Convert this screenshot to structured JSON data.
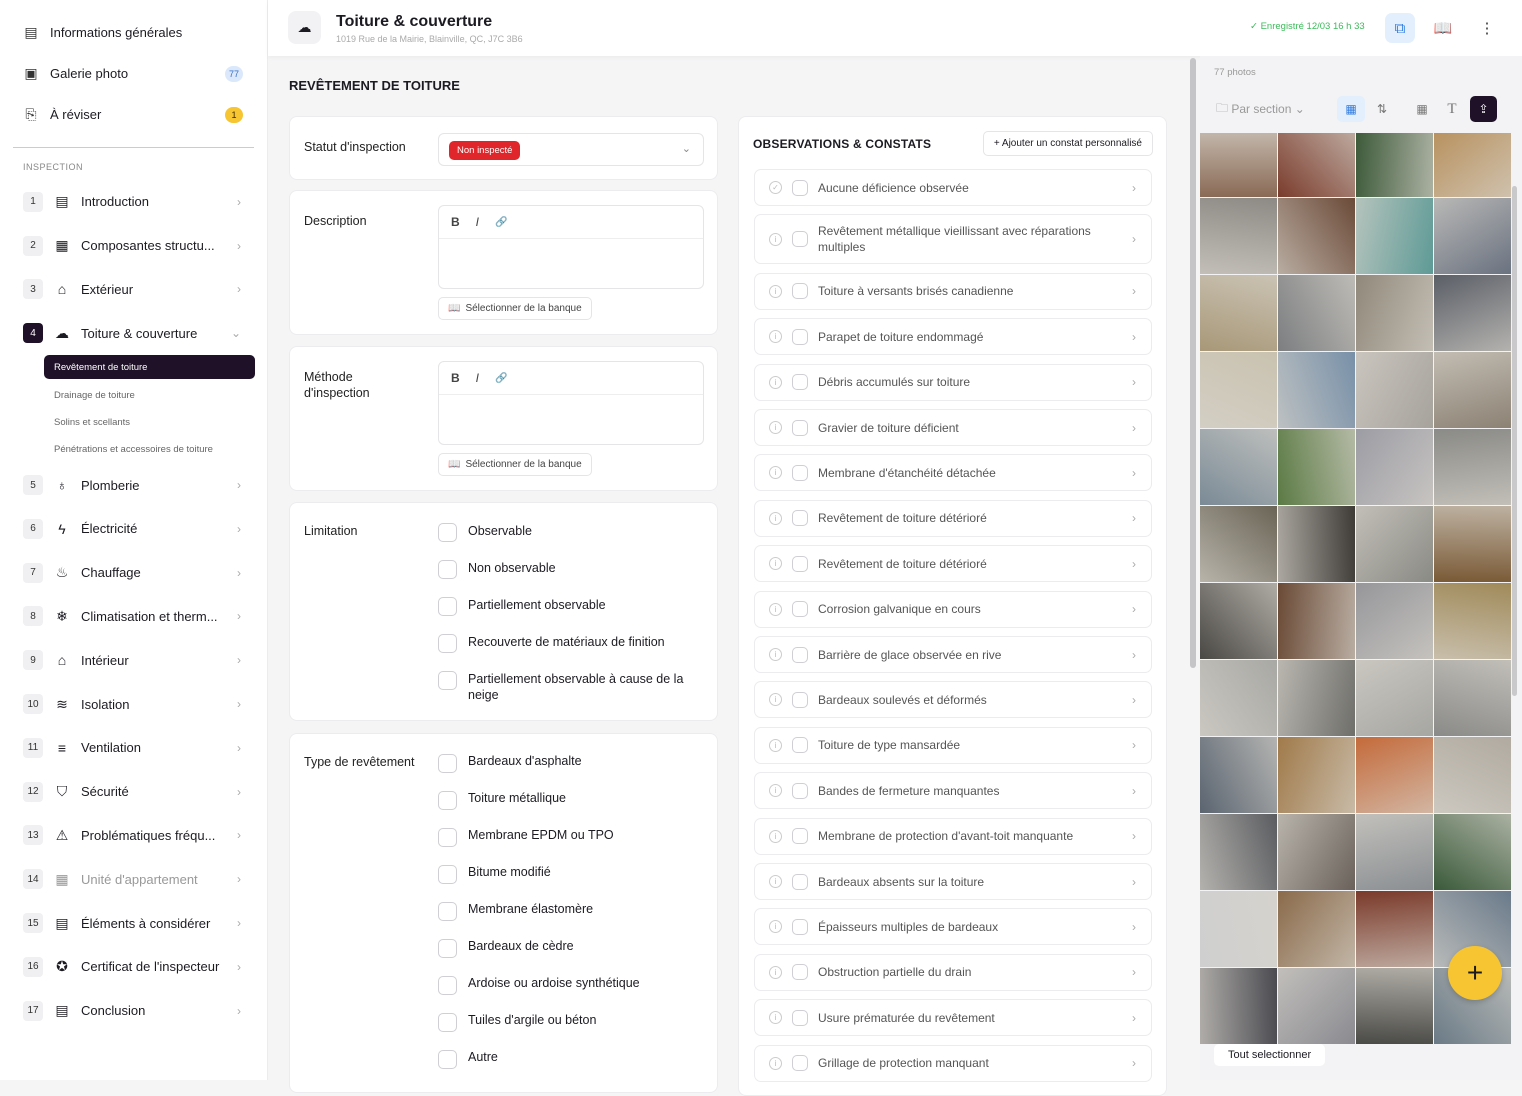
{
  "sidebar": {
    "top": [
      {
        "icon": "document-icon",
        "glyph": "▤",
        "label": "Informations générales"
      },
      {
        "icon": "gallery-icon",
        "glyph": "▣",
        "label": "Galerie photo",
        "badge": "77"
      },
      {
        "icon": "review-icon",
        "glyph": "⎘",
        "label": "À réviser",
        "badge": "1"
      }
    ],
    "section_label": "INSPECTION",
    "items": [
      {
        "num": "1",
        "icon": "document-icon",
        "glyph": "▤",
        "label": "Introduction"
      },
      {
        "num": "2",
        "icon": "building-icon",
        "glyph": "▦",
        "label": "Composantes structu...",
        "chev": true
      },
      {
        "num": "3",
        "icon": "house-icon",
        "glyph": "⌂",
        "label": "Extérieur",
        "chev": true
      },
      {
        "num": "4",
        "icon": "cloud-rain-icon",
        "glyph": "☁",
        "label": "Toiture & couverture",
        "open": true
      },
      {
        "num": "5",
        "icon": "plumbing-icon",
        "glyph": "♁",
        "label": "Plomberie",
        "chev": true
      },
      {
        "num": "6",
        "icon": "lightning-icon",
        "glyph": "ϟ",
        "label": "Électricité",
        "chev": true
      },
      {
        "num": "7",
        "icon": "flame-icon",
        "glyph": "♨",
        "label": "Chauffage",
        "chev": true
      },
      {
        "num": "8",
        "icon": "snowflake-icon",
        "glyph": "❄",
        "label": "Climatisation et therm...",
        "chev": true
      },
      {
        "num": "9",
        "icon": "house-icon",
        "glyph": "⌂",
        "label": "Intérieur",
        "chev": true
      },
      {
        "num": "10",
        "icon": "layers-icon",
        "glyph": "≋",
        "label": "Isolation",
        "chev": true
      },
      {
        "num": "11",
        "icon": "wind-icon",
        "glyph": "≡",
        "label": "Ventilation",
        "chev": true
      },
      {
        "num": "12",
        "icon": "shield-icon",
        "glyph": "⛉",
        "label": "Sécurité",
        "chev": true
      },
      {
        "num": "13",
        "icon": "warning-icon",
        "glyph": "⚠",
        "label": "Problématiques fréqu...",
        "chev": true
      },
      {
        "num": "14",
        "icon": "apartment-icon",
        "glyph": "▦",
        "label": "Unité d'appartement",
        "chev": true,
        "disabled": true
      },
      {
        "num": "15",
        "icon": "document-icon",
        "glyph": "▤",
        "label": "Éléments à considérer"
      },
      {
        "num": "16",
        "icon": "award-icon",
        "glyph": "✪",
        "label": "Certificat de l'inspecteur"
      },
      {
        "num": "17",
        "icon": "document-icon",
        "glyph": "▤",
        "label": "Conclusion"
      }
    ],
    "subitems": [
      "Revêtement de toiture",
      "Drainage de toiture",
      "Solins et scellants",
      "Pénétrations et accessoires de toiture"
    ]
  },
  "header": {
    "title": "Toiture & couverture",
    "address": "1019 Rue de la Mairie, Blainville, QC, J7C 3B6",
    "saved": "✓  Enregistré 12/03 16 h 33"
  },
  "main": {
    "section_title": "REVÊTEMENT DE TOITURE",
    "status_label": "Statut d'inspection",
    "status_value": "Non inspecté",
    "description_label": "Description",
    "method_label": "Méthode d'inspection",
    "bold": "B",
    "italic": "I",
    "link": "🔗",
    "bank_button": "Sélectionner de la banque",
    "limitation_label": "Limitation",
    "limitations": [
      "Observable",
      "Non observable",
      "Partiellement observable",
      "Recouverte de matériaux de finition",
      "Partiellement observable à cause de la neige"
    ],
    "type_label": "Type de revêtement",
    "types": [
      "Bardeaux d'asphalte",
      "Toiture métallique",
      "Membrane EPDM ou TPO",
      "Bitume modifié",
      "Membrane élastomère",
      "Bardeaux de cèdre",
      "Ardoise ou ardoise synthétique",
      "Tuiles d'argile ou béton",
      "Autre"
    ]
  },
  "observations": {
    "title": "OBSERVATIONS & CONSTATS",
    "add_button": "+ Ajouter un constat personnalisé",
    "items": [
      "Aucune déficience observée",
      "Revêtement métallique vieillissant avec réparations multiples",
      "Toiture à versants brisés canadienne",
      "Parapet de toiture endommagé",
      "Débris accumulés sur toiture",
      "Gravier de toiture déficient",
      "Membrane d'étanchéité détachée",
      "Revêtement de toiture détérioré",
      "Revêtement de toiture détérioré",
      "Corrosion galvanique en cours",
      "Barrière de glace observée en rive",
      "Bardeaux soulevés et déformés",
      "Toiture de type mansardée",
      "Bandes de fermeture manquantes",
      "Membrane de protection d'avant-toit manquante",
      "Bardeaux absents sur la toiture",
      "Épaisseurs multiples de bardeaux",
      "Obstruction partielle du drain",
      "Usure prématurée du revêtement",
      "Grillage de protection manquant"
    ]
  },
  "photos": {
    "count": "77 photos",
    "group_by": "Par section",
    "select_all": "Tout selectionner",
    "colors": [
      "#8a6a55",
      "#7a3c2c",
      "#3d5a3a",
      "#b89260",
      "#8d8a85",
      "#6b4a38",
      "#5e9a96",
      "#6a7280",
      "#a89878",
      "#7c7e80",
      "#90887a",
      "#5a5e66",
      "#c9c2b0",
      "#7890a8",
      "#a6a29c",
      "#8c8274",
      "#7a8a96",
      "#5b7a44",
      "#9c9ca4",
      "#8a8a86",
      "#6a6456",
      "#3e3a36",
      "#8a8a84",
      "#7a5a36",
      "#4a4844",
      "#6a4a36",
      "#96969a",
      "#a08a5a",
      "#a8a8a4",
      "#6e6e6a",
      "#a6a6a2",
      "#8a8a88",
      "#5a6470",
      "#a07a4a",
      "#c46a3a",
      "#b0aaa0",
      "#5a5c60",
      "#6a625a",
      "#8a8e92",
      "#3a5a3a",
      "#cfcfcf",
      "#8a6a4a",
      "#7a3a2a",
      "#6a7a8a",
      "#4a4a50",
      "#8a8a90",
      "#4a4a46",
      "#6a7a86"
    ]
  }
}
